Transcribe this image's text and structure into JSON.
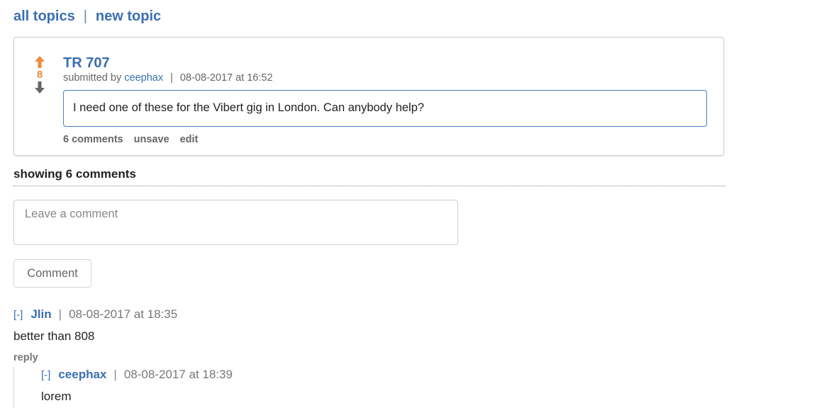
{
  "nav": {
    "all_topics": "all topics",
    "separator": "|",
    "new_topic": "new topic"
  },
  "post": {
    "score": "8",
    "title": "TR 707",
    "submitted_by_label": "submitted by",
    "author": "ceephax",
    "separator": "|",
    "timestamp": "08-08-2017 at 16:52",
    "body": "I need one of these for the Vibert gig in London. Can anybody help?",
    "actions": {
      "comments": "6 comments",
      "unsave": "unsave",
      "edit": "edit"
    }
  },
  "comments_header": "showing 6 comments",
  "comment_form": {
    "placeholder": "Leave a comment",
    "value": "",
    "button_label": "Comment"
  },
  "comments": [
    {
      "toggle": "[-]",
      "author": "Jlin",
      "separator": "|",
      "timestamp": "08-08-2017 at 18:35",
      "text": "better than 808",
      "reply_label": "reply"
    },
    {
      "toggle": "[-]",
      "author": "ceephax",
      "separator": "|",
      "timestamp": "08-08-2017 at 18:39",
      "text": "lorem"
    }
  ],
  "colors": {
    "link": "#3a6fb0",
    "upvote": "#f08a3a",
    "downvote": "#666666",
    "focus_border": "#4a7fc0"
  },
  "icons": {
    "upvote": "arrow-up-icon",
    "downvote": "arrow-down-icon"
  }
}
